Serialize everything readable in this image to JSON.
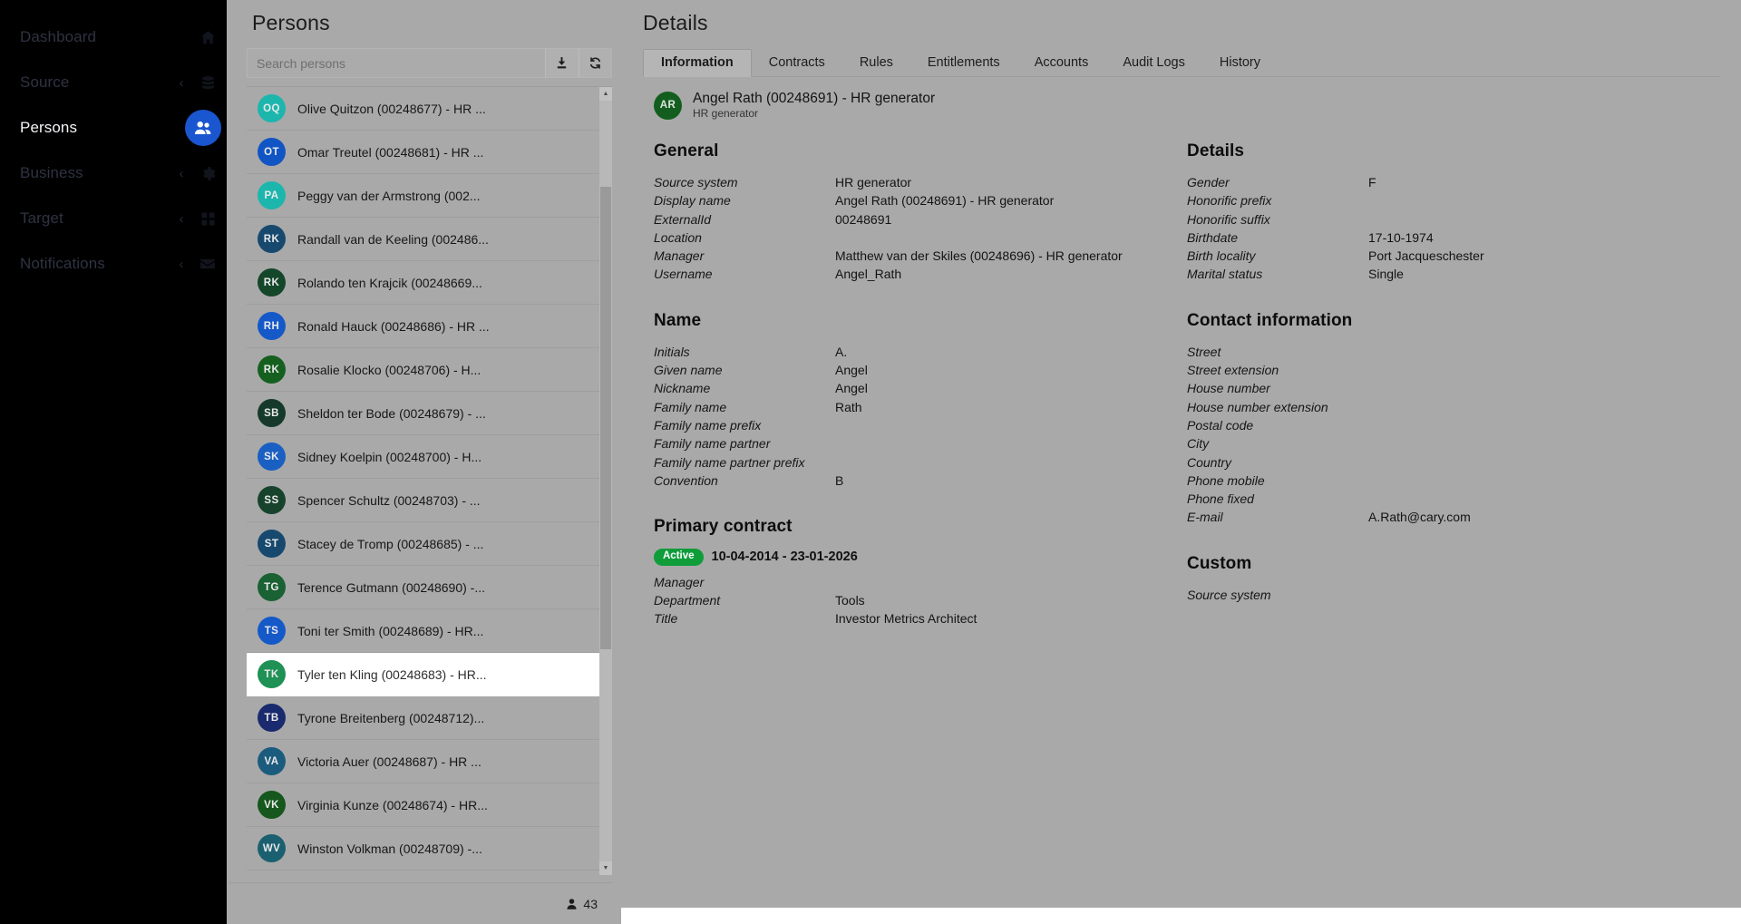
{
  "sidebar": {
    "items": [
      {
        "label": "Dashboard",
        "icon": "home-icon",
        "chevron": false,
        "active": false,
        "badge": false
      },
      {
        "label": "Source",
        "icon": "database-icon",
        "chevron": true,
        "active": false,
        "badge": false
      },
      {
        "label": "Persons",
        "icon": "people-icon",
        "chevron": false,
        "active": true,
        "badge": true
      },
      {
        "label": "Business",
        "icon": "gear-icon",
        "chevron": true,
        "active": false,
        "badge": false
      },
      {
        "label": "Target",
        "icon": "grid-icon",
        "chevron": true,
        "active": false,
        "badge": false
      },
      {
        "label": "Notifications",
        "icon": "envelope-icon",
        "chevron": true,
        "active": false,
        "badge": false
      }
    ]
  },
  "persons": {
    "title": "Persons",
    "search": {
      "value": "",
      "placeholder": "Search persons"
    },
    "buttons": {
      "download": "download-icon",
      "refresh": "refresh-icon"
    },
    "footer_count": "43",
    "footer_icon": "person-icon",
    "items": [
      {
        "initials": "OQ",
        "color": "#1cb6ad",
        "label": "Olive Quitzon (00248677) - HR ..."
      },
      {
        "initials": "OT",
        "color": "#1155c4",
        "label": "Omar Treutel (00248681) - HR ..."
      },
      {
        "initials": "PA",
        "color": "#1cb6ad",
        "label": "Peggy van der Armstrong (002..."
      },
      {
        "initials": "RK",
        "color": "#17496e",
        "label": "Randall van de Keeling (002486..."
      },
      {
        "initials": "RK",
        "color": "#14462a",
        "label": "Rolando ten Krajcik (00248669..."
      },
      {
        "initials": "RH",
        "color": "#1559c9",
        "label": "Ronald Hauck (00248686) - HR ..."
      },
      {
        "initials": "RK",
        "color": "#15601f",
        "label": "Rosalie Klocko (00248706) - H..."
      },
      {
        "initials": "SB",
        "color": "#153a2c",
        "label": "Sheldon ter Bode (00248679) - ..."
      },
      {
        "initials": "SK",
        "color": "#1a5fc2",
        "label": "Sidney Koelpin (00248700) - H..."
      },
      {
        "initials": "SS",
        "color": "#17432c",
        "label": "Spencer Schultz (00248703) - ..."
      },
      {
        "initials": "ST",
        "color": "#17496e",
        "label": "Stacey de Tromp (00248685) - ..."
      },
      {
        "initials": "TG",
        "color": "#1a6133",
        "label": "Terence Gutmann (00248690) -..."
      },
      {
        "initials": "TS",
        "color": "#1559c9",
        "label": "Toni ter Smith (00248689) - HR..."
      },
      {
        "initials": "TK",
        "color": "#1f9155",
        "label": "Tyler ten Kling (00248683) - HR...",
        "selected": true
      },
      {
        "initials": "TB",
        "color": "#1a2a6e",
        "label": "Tyrone Breitenberg (00248712)..."
      },
      {
        "initials": "VA",
        "color": "#1b5c7e",
        "label": "Victoria Auer (00248687) - HR ..."
      },
      {
        "initials": "VK",
        "color": "#15571d",
        "label": "Virginia Kunze (00248674) - HR..."
      },
      {
        "initials": "WV",
        "color": "#1b6070",
        "label": "Winston Volkman (00248709) -..."
      }
    ]
  },
  "details": {
    "title": "Details",
    "tabs": [
      {
        "label": "Information",
        "active": true
      },
      {
        "label": "Contracts",
        "active": false
      },
      {
        "label": "Rules",
        "active": false
      },
      {
        "label": "Entitlements",
        "active": false
      },
      {
        "label": "Accounts",
        "active": false
      },
      {
        "label": "Audit Logs",
        "active": false
      },
      {
        "label": "History",
        "active": false
      }
    ],
    "person": {
      "initials": "AR",
      "avatar_color": "#135e1e",
      "name": "Angel Rath (00248691) - HR generator",
      "subtitle": "HR generator"
    },
    "general": {
      "title": "General",
      "fields": [
        {
          "key": "Source system",
          "value": "HR generator"
        },
        {
          "key": "Display name",
          "value": "Angel Rath (00248691) - HR generator"
        },
        {
          "key": "ExternalId",
          "value": "00248691"
        },
        {
          "key": "Location",
          "value": ""
        },
        {
          "key": "Manager",
          "value": "Matthew van der Skiles (00248696) - HR generator"
        },
        {
          "key": "Username",
          "value": "Angel_Rath"
        }
      ]
    },
    "name": {
      "title": "Name",
      "fields": [
        {
          "key": "Initials",
          "value": "A."
        },
        {
          "key": "Given name",
          "value": "Angel"
        },
        {
          "key": "Nickname",
          "value": "Angel"
        },
        {
          "key": "Family name",
          "value": "Rath"
        },
        {
          "key": "Family name prefix",
          "value": ""
        },
        {
          "key": "Family name partner",
          "value": ""
        },
        {
          "key": "Family name partner prefix",
          "value": ""
        },
        {
          "key": "Convention",
          "value": "B"
        }
      ]
    },
    "primary_contract": {
      "title": "Primary contract",
      "status": "Active",
      "status_color": "#0f9d3a",
      "dates": "10-04-2014 - 23-01-2026",
      "fields": [
        {
          "key": "Manager",
          "value": ""
        },
        {
          "key": "Department",
          "value": "Tools"
        },
        {
          "key": "Title",
          "value": "Investor Metrics Architect"
        }
      ]
    },
    "details_section": {
      "title": "Details",
      "fields": [
        {
          "key": "Gender",
          "value": "F"
        },
        {
          "key": "Honorific prefix",
          "value": ""
        },
        {
          "key": "Honorific suffix",
          "value": ""
        },
        {
          "key": "Birthdate",
          "value": "17-10-1974"
        },
        {
          "key": "Birth locality",
          "value": "Port Jacqueschester"
        },
        {
          "key": "Marital status",
          "value": "Single"
        }
      ]
    },
    "contact": {
      "title": "Contact information",
      "fields": [
        {
          "key": "Street",
          "value": ""
        },
        {
          "key": "Street extension",
          "value": ""
        },
        {
          "key": "House number",
          "value": ""
        },
        {
          "key": "House number extension",
          "value": ""
        },
        {
          "key": "Postal code",
          "value": ""
        },
        {
          "key": "City",
          "value": ""
        },
        {
          "key": "Country",
          "value": ""
        },
        {
          "key": "Phone mobile",
          "value": ""
        },
        {
          "key": "Phone fixed",
          "value": ""
        },
        {
          "key": "E-mail",
          "value": "A.Rath@cary.com"
        }
      ]
    },
    "custom": {
      "title": "Custom",
      "fields": [
        {
          "key": "Source system",
          "value": ""
        }
      ]
    }
  }
}
